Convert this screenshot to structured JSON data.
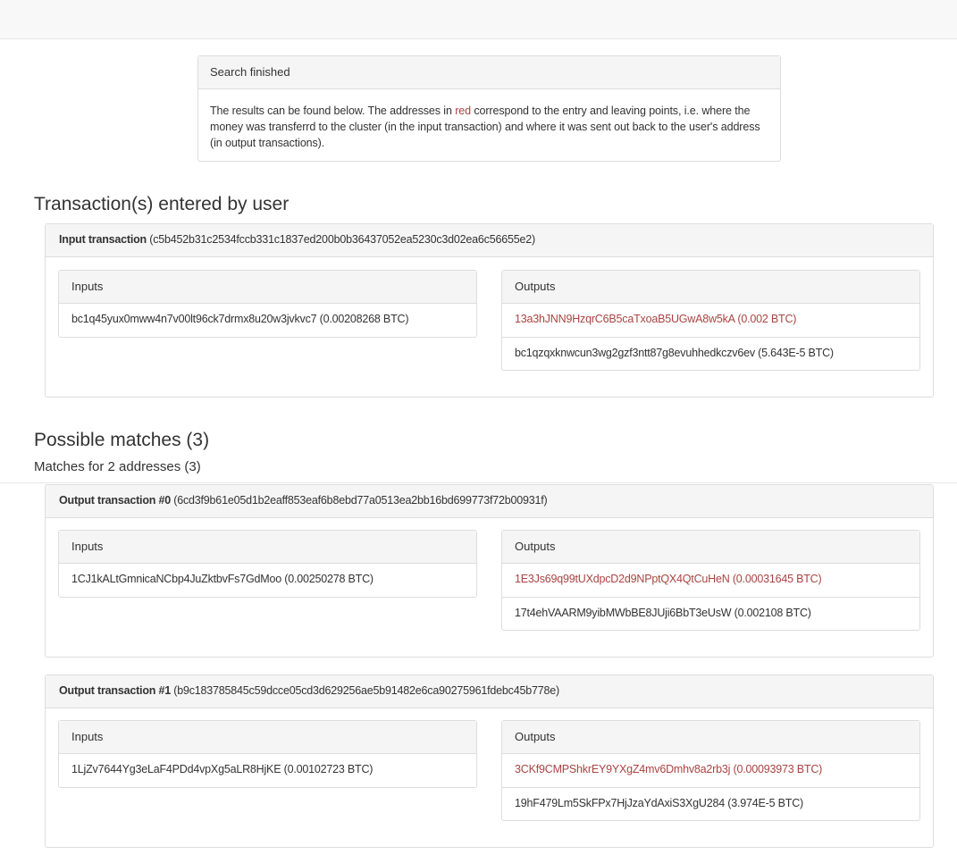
{
  "alert": {
    "heading": "Search finished",
    "text_before": "The results can be found below. The addresses in ",
    "text_red": "red",
    "text_after": " correspond to the entry and leaving points, i.e. where the money was transferrd to the cluster (in the input transaction) and where it was sent out back to the user's address (in output transactions).",
    "accent_color": "#a94442"
  },
  "entered": {
    "title": "Transaction(s) entered by user",
    "tx": {
      "label": "Input transaction",
      "hash": "(c5b452b31c2534fccb331c1837ed200b0b36437052ea5230c3d02ea6c56655e2)",
      "inputs_label": "Inputs",
      "outputs_label": "Outputs",
      "inputs": [
        {
          "text": "bc1q45yux0mww4n7v00lt96ck7drmx8u20w3jvkvc7  (0.00208268 BTC)",
          "highlight": false
        }
      ],
      "outputs": [
        {
          "text": "13a3hJNN9HzqrC6B5caTxoaB5UGwA8w5kA  (0.002 BTC)",
          "highlight": true
        },
        {
          "text": "bc1qzqxknwcun3wg2gzf3ntt87g8evuhhedkczv6ev  (5.643E-5 BTC)",
          "highlight": false
        }
      ]
    }
  },
  "matches": {
    "title": "Possible matches (3)",
    "subtitle": "Matches for 2 addresses (3)",
    "txs": [
      {
        "label": "Output transaction #0",
        "hash": "(6cd3f9b61e05d1b2eaff853eaf6b8ebd77a0513ea2bb16bd699773f72b00931f)",
        "inputs_label": "Inputs",
        "outputs_label": "Outputs",
        "inputs": [
          {
            "text": "1CJ1kALtGmnicaNCbp4JuZktbvFs7GdMoo  (0.00250278 BTC)",
            "highlight": false
          }
        ],
        "outputs": [
          {
            "text": "1E3Js69q99tUXdpcD2d9NPptQX4QtCuHeN  (0.00031645 BTC)",
            "highlight": true
          },
          {
            "text": "17t4ehVAARM9yibMWbBE8JUji6BbT3eUsW  (0.002108 BTC)",
            "highlight": false
          }
        ]
      },
      {
        "label": "Output transaction #1",
        "hash": "(b9c183785845c59dcce05cd3d629256ae5b91482e6ca90275961fdebc45b778e)",
        "inputs_label": "Inputs",
        "outputs_label": "Outputs",
        "inputs": [
          {
            "text": "1LjZv7644Yg3eLaF4PDd4vpXg5aLR8HjKE  (0.00102723 BTC)",
            "highlight": false
          }
        ],
        "outputs": [
          {
            "text": "3CKf9CMPShkrEY9YXgZ4mv6Dmhv8a2rb3j  (0.00093973 BTC)",
            "highlight": true
          },
          {
            "text": "19hF479Lm5SkFPx7HjJzaYdAxiS3XgU284  (3.974E-5 BTC)",
            "highlight": false
          }
        ]
      }
    ]
  }
}
